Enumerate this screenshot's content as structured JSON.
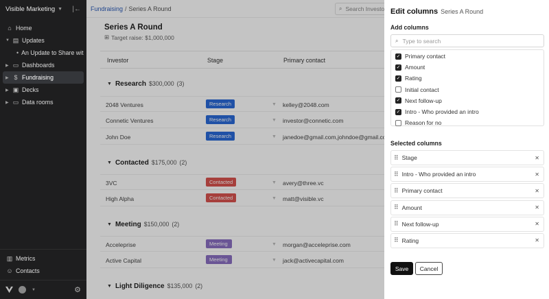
{
  "sidebar": {
    "workspace": "Visible Marketing",
    "nav": [
      {
        "label": "Home",
        "icon": "home-icon"
      },
      {
        "label": "Updates",
        "icon": "document-icon"
      },
      {
        "label": "An Update to Share with ...",
        "icon": "bullet"
      },
      {
        "label": "Dashboards",
        "icon": "folder-icon"
      },
      {
        "label": "Fundraising",
        "icon": "dollar-icon"
      },
      {
        "label": "Decks",
        "icon": "deck-icon"
      },
      {
        "label": "Data rooms",
        "icon": "folder-icon"
      }
    ],
    "bottom_nav": [
      {
        "label": "Metrics",
        "icon": "chart-icon"
      },
      {
        "label": "Contacts",
        "icon": "contacts-icon"
      }
    ]
  },
  "topbar": {
    "breadcrumb_root": "Fundraising",
    "breadcrumb_sep": "/",
    "breadcrumb_current": "Series A Round",
    "search_placeholder": "Search Investors"
  },
  "page": {
    "title": "Series A Round",
    "target_raise": "Target raise: $1,000,000"
  },
  "table": {
    "columns": [
      "Investor",
      "Stage",
      "Primary contact"
    ],
    "groups": [
      {
        "name": "Research",
        "amount": "$300,000",
        "count": "(3)",
        "color": "#2a6ad9",
        "rows": [
          {
            "investor": "2048 Ventures",
            "stage": "Research",
            "contact": "kelley@2048.com"
          },
          {
            "investor": "Connetic Ventures",
            "stage": "Research",
            "contact": "investor@connetic.com"
          },
          {
            "investor": "John Doe",
            "stage": "Research",
            "contact": "janedoe@gmail.com,johndoe@gmail.com"
          }
        ]
      },
      {
        "name": "Contacted",
        "amount": "$175,000",
        "count": "(2)",
        "color": "#d9534f",
        "rows": [
          {
            "investor": "3VC",
            "stage": "Contacted",
            "contact": "avery@three.vc"
          },
          {
            "investor": "High Alpha",
            "stage": "Contacted",
            "contact": "matt@visible.vc"
          }
        ]
      },
      {
        "name": "Meeting",
        "amount": "$150,000",
        "count": "(2)",
        "color": "#8a6fc2",
        "rows": [
          {
            "investor": "Acceleprise",
            "stage": "Meeting",
            "contact": "morgan@acceleprise.com"
          },
          {
            "investor": "Active Capital",
            "stage": "Meeting",
            "contact": "jack@activecapital.com"
          }
        ]
      },
      {
        "name": "Light Diligence",
        "amount": "$135,000",
        "count": "(2)",
        "color": "#888888",
        "rows": []
      }
    ]
  },
  "panel": {
    "title": "Edit columns",
    "subtitle": "Series A Round",
    "add_label": "Add columns",
    "search_placeholder": "Type to search",
    "options": [
      {
        "label": "Primary contact",
        "checked": true
      },
      {
        "label": "Amount",
        "checked": true
      },
      {
        "label": "Rating",
        "checked": true
      },
      {
        "label": "Initial contact",
        "checked": false
      },
      {
        "label": "Next follow-up",
        "checked": true
      },
      {
        "label": "Intro - Who provided an intro",
        "checked": true
      },
      {
        "label": "Reason for no",
        "checked": false
      }
    ],
    "selected_label": "Selected columns",
    "selected": [
      "Stage",
      "Intro - Who provided an intro",
      "Primary contact",
      "Amount",
      "Next follow-up",
      "Rating"
    ],
    "save_label": "Save",
    "cancel_label": "Cancel"
  }
}
